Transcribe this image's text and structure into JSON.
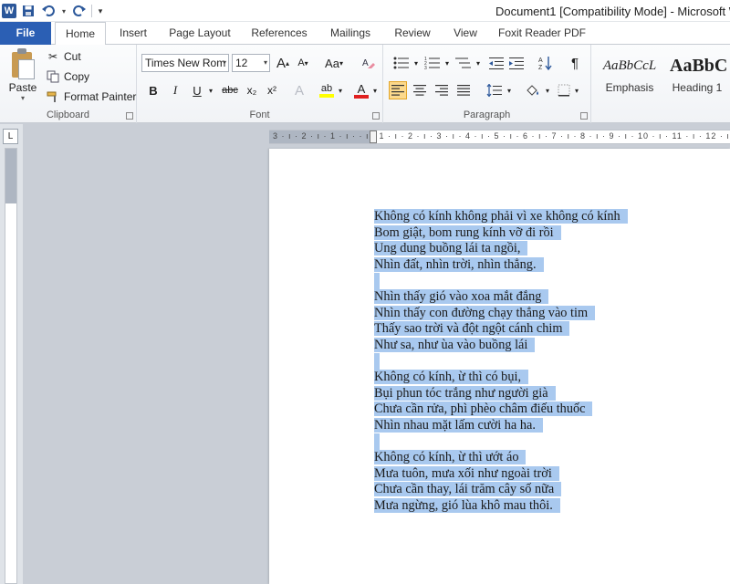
{
  "titlebar": {
    "app_letter": "W",
    "title": "Document1 [Compatibility Mode]  -  Microsoft W"
  },
  "tabs": [
    {
      "label": "File"
    },
    {
      "label": "Home"
    },
    {
      "label": "Insert"
    },
    {
      "label": "Page Layout"
    },
    {
      "label": "References"
    },
    {
      "label": "Mailings"
    },
    {
      "label": "Review"
    },
    {
      "label": "View"
    },
    {
      "label": "Foxit Reader PDF"
    }
  ],
  "active_tab": "Home",
  "ribbon": {
    "clipboard": {
      "label": "Clipboard",
      "paste": "Paste",
      "cut": "Cut",
      "copy": "Copy",
      "format_painter": "Format Painter"
    },
    "font": {
      "label": "Font",
      "font_name": "Times New Rom",
      "font_size": "12",
      "grow": "A",
      "shrink": "A",
      "change_case": "Aa",
      "bold": "B",
      "italic": "I",
      "underline": "U",
      "strikethrough": "abc",
      "subscript": "x₂",
      "superscript": "x²",
      "text_effects": "A",
      "highlight": "ab",
      "font_color": "A",
      "highlight_color": "#ffff00",
      "font_color_value": "#e02020"
    },
    "paragraph": {
      "label": "Paragraph",
      "pilcrow": "¶"
    },
    "styles": {
      "items": [
        {
          "sample": "AaBbCcL",
          "name": "Emphasis"
        },
        {
          "sample": "AaBbC",
          "name": "Heading 1"
        }
      ]
    }
  },
  "ruler": {
    "horizontal_ticks": "3 · ı · 2 · ı · 1 · ı ·   · ı · 1 · ı · 2 · ı · 3 · ı · 4 · ı · 5 · ı · 6 · ı · 7 · ı · 8 · ı · 9 · ı · 10 · ı · 11 · ı · 12 · ı"
  },
  "document": {
    "selection_color": "#a9c9ef",
    "lines": [
      "Không có kính không phải vì xe không có kính",
      "Bom giật, bom rung kính vỡ đi rồi",
      "Ung dung buồng lái ta ngồi,",
      "Nhìn đất, nhìn trời, nhìn thẳng.",
      "",
      "Nhìn thấy gió vào xoa mắt đắng",
      "Nhìn thấy con đường chạy thẳng vào tim",
      "Thấy sao trời và đột ngột cánh chim",
      "Như sa, như ùa vào buồng lái",
      "",
      "Không có kính, ừ thì có bụi,",
      "Bụi phun tóc trắng như người già",
      "Chưa cần rửa, phì phèo châm điếu thuốc",
      "Nhìn nhau mặt lấm cười ha ha.",
      "",
      "Không có kính, ừ thì ướt áo",
      "Mưa tuôn, mưa xối như ngoài trời",
      "Chưa cần thay, lái trăm cây số nữa",
      "Mưa ngừng, gió lùa khô mau thôi."
    ]
  }
}
